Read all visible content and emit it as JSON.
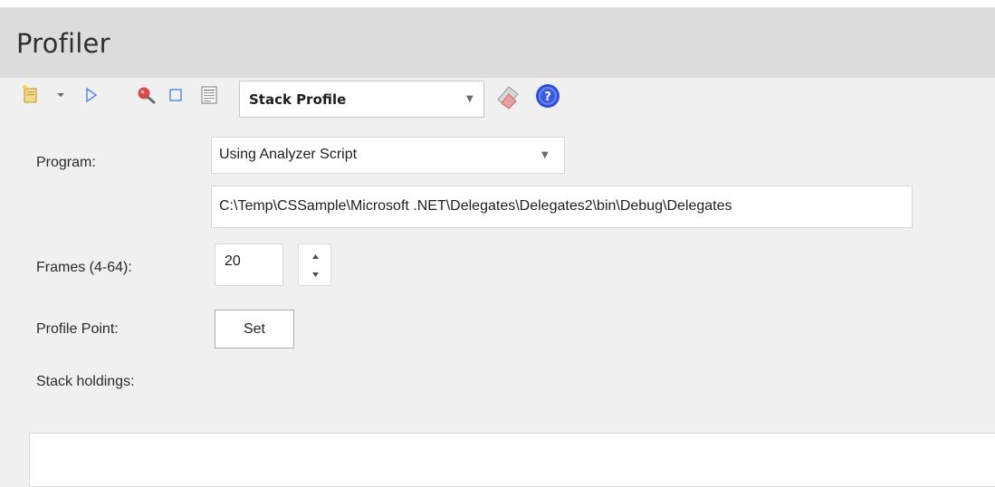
{
  "panel": {
    "title": "Profiler"
  },
  "toolbar": {
    "icons": [
      "new-script-icon",
      "dropdown-arrow-icon",
      "run-icon",
      "search-icon",
      "stop-icon",
      "report-icon",
      "clear-icon",
      "help-icon"
    ],
    "profile_type": {
      "selected": "Stack Profile"
    }
  },
  "form": {
    "program_label": "Program:",
    "program_mode": "Using Analyzer Script",
    "program_path": "C:\\Temp\\CSSample\\Microsoft .NET\\Delegates\\Delegates2\\bin\\Debug\\Delegates",
    "frames_label": "Frames (4-64):",
    "frames_value": "20",
    "profile_point_label": "Profile Point:",
    "set_button_label": "Set",
    "stack_holdings_label": "Stack holdings:"
  },
  "colors": {
    "title_bar_bg": "#dcdcdc",
    "panel_bg": "#f0f0f0",
    "help_icon_blue": "#2e4ed8",
    "run_icon_blue": "#4a86e8",
    "search_icon_red": "#d84a4a"
  }
}
